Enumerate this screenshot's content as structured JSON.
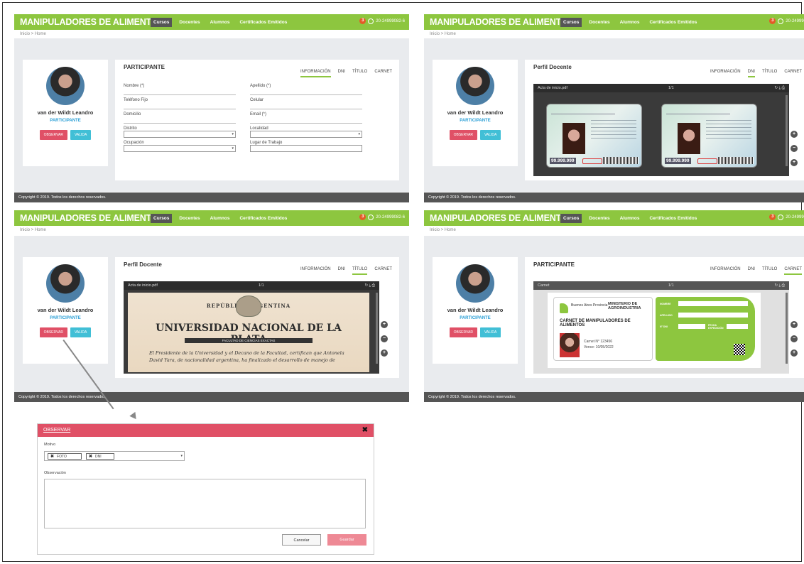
{
  "app": {
    "brand": "MANIPULADORES DE ALIMENTOS",
    "nav": [
      "Cursos",
      "Docentes",
      "Alumnos",
      "Certificados Emitidos"
    ],
    "notif_count": "3",
    "user_code": "20-24999082-6",
    "breadcrumb": "Inicio > Home",
    "footer": "Copyright © 2019. Todos los derechos reservados."
  },
  "profile": {
    "name": "van der Wildt Leandro",
    "role": "PARTICIPANTE",
    "observe_label": "OBSERVAR",
    "validate_label": "VALIDA"
  },
  "panel1": {
    "title": "PARTICIPANTE",
    "tabs": [
      "INFORMACIÓN",
      "DNI",
      "TÍTULO",
      "CARNET"
    ],
    "fields": [
      "Nombre (*)",
      "Apellido (*)",
      "Teléfono Fijo",
      "Celular",
      "Domicilio",
      "Email (*)",
      "Distrito",
      "Localidad",
      "Ocupación",
      "Lugar de Trabajo"
    ]
  },
  "panel2": {
    "title": "Perfil Docente",
    "tabs": [
      "INFORMACIÓN",
      "DNI",
      "TÍTULO",
      "CARNET"
    ],
    "viewer_file": "Acta de inicio.pdf",
    "viewer_page": "1/1",
    "viewer_icons": "↻ ⤓ ⎙",
    "dni_number": "99.999.999"
  },
  "panel3": {
    "title": "Perfil Docente",
    "tabs": [
      "INFORMACIÓN",
      "DNI",
      "TÍTULO",
      "CARNET"
    ],
    "viewer_file": "Acta de inicio.pdf",
    "viewer_page": "1/1",
    "viewer_icons": "↻ ⤓ ⎙",
    "diploma_republic": "REPÚBLICA  ARGENTINA",
    "diploma_university": "UNIVERSIDAD NACIONAL DE LA PLATA",
    "diploma_faculty": "FACULTAD DE CIENCIAS EXACTAS",
    "diploma_text": "El Presidente de la Universidad y el Decano de la Facultad, certifican que Antonela David Yara, de nacionalidad argentina, ha finalizado el desarrollo de manejo de"
  },
  "panel4": {
    "title": "PARTICIPANTE",
    "tabs": [
      "INFORMACIÓN",
      "DNI",
      "TÍTULO",
      "CARNET"
    ],
    "viewer_file": "Carnet",
    "viewer_page": "1/1",
    "viewer_icons": "↻ ⤓ ⎙",
    "carnet_gov": "Buenos Aires Provincia",
    "carnet_ministry": "MINISTERIO DE AGROINDUSTRIA",
    "carnet_title": "CARNET DE MANIPULADORES DE ALIMENTOS",
    "carnet_number": "Carnet N° 123456",
    "carnet_expiry": "Vence: 10/05/2022",
    "carnet_fields": [
      "NOMBRE",
      "APELLIDO",
      "N° DNI",
      "FECHA EXPEDICIÓN"
    ]
  },
  "modal": {
    "title": "OBSERVAR",
    "motive_label": "Motivo",
    "chips": [
      "FOTO",
      "DNI"
    ],
    "observation_label": "Observación",
    "cancel_label": "Cancelar",
    "save_label": "Guardar"
  },
  "colors": {
    "brand_green": "#8dc63f",
    "observe_red": "#e05066",
    "validate_cyan": "#41bfd6",
    "footer_gray": "#555555"
  }
}
